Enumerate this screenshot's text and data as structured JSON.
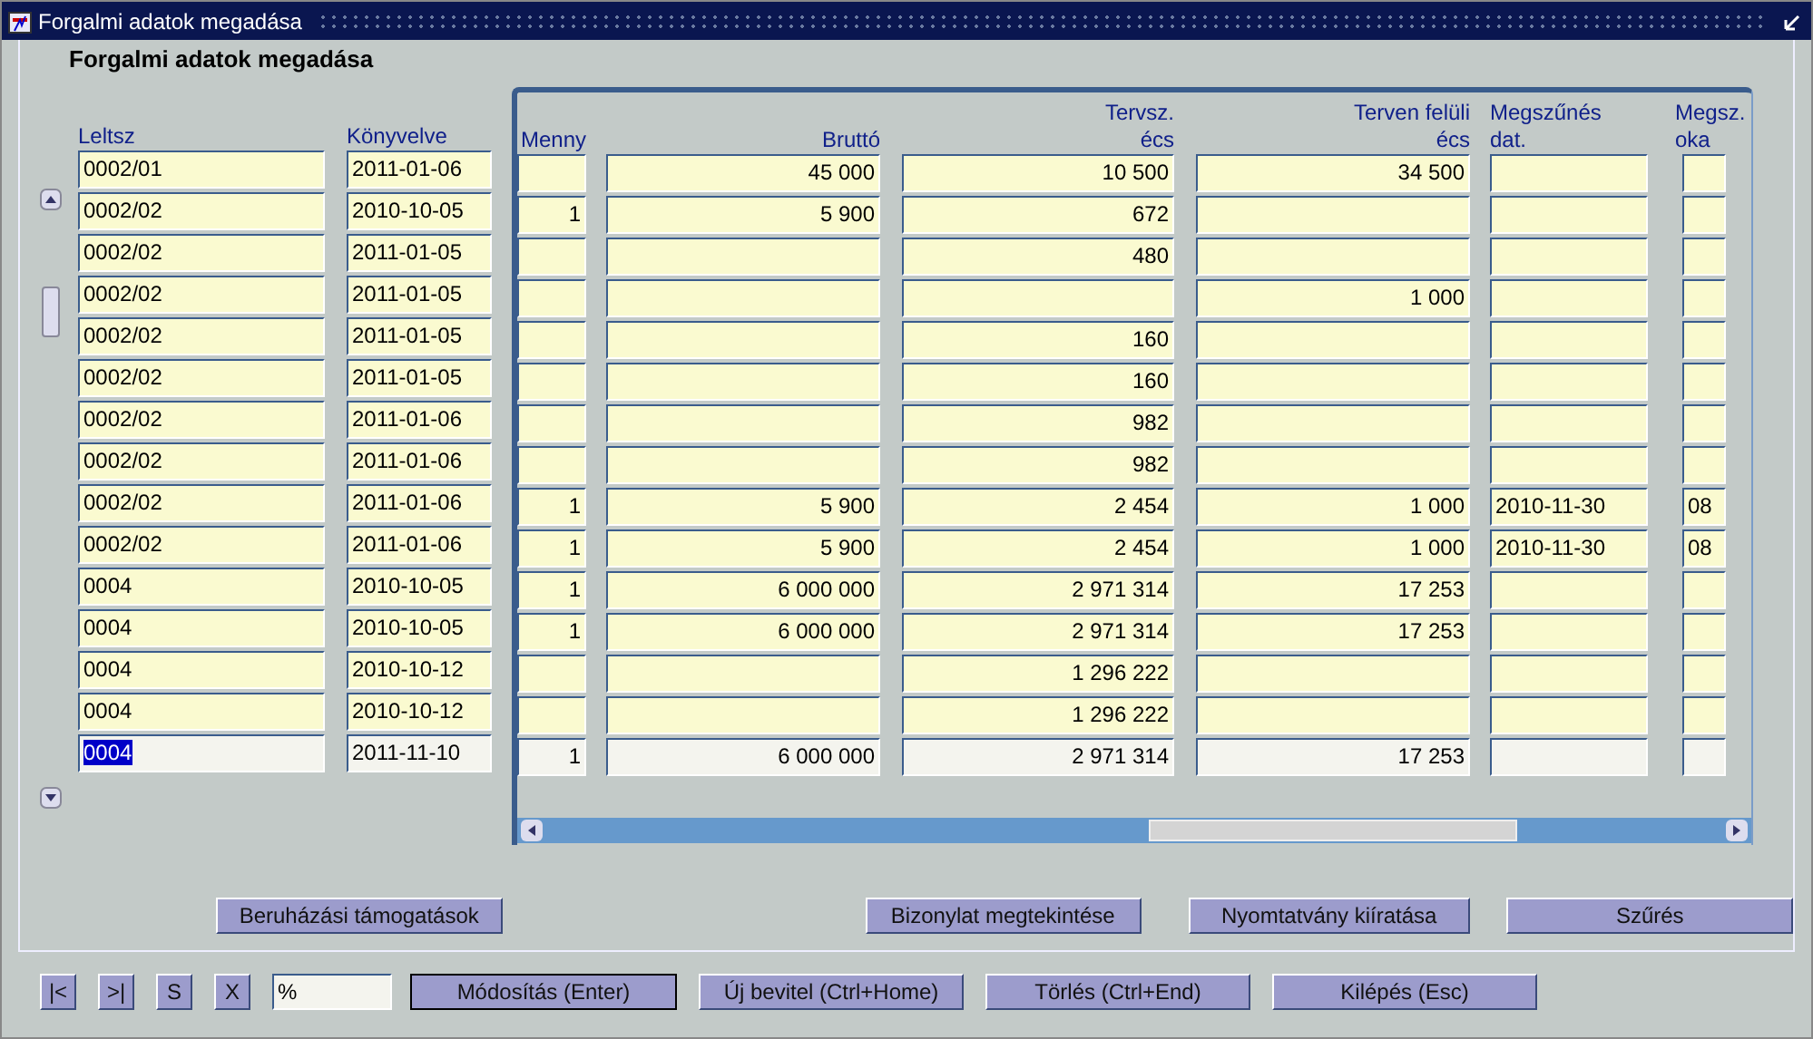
{
  "window": {
    "title": "Forgalmi adatok megadása"
  },
  "form_title": "Forgalmi adatok megadása",
  "columns": [
    {
      "label": "Leltsz"
    },
    {
      "label": "Könyvelve"
    },
    {
      "label": "Menny"
    },
    {
      "label": "Bruttó"
    },
    {
      "label": "Tervsz. écs"
    },
    {
      "label": "Terven felüli écs"
    },
    {
      "label": "Megszűnés dat."
    },
    {
      "label": "Megsz. oka"
    }
  ],
  "rows": [
    {
      "selected": false,
      "cells": [
        "0002/01",
        "2011-01-06",
        "",
        "45 000",
        "10 500",
        "34 500",
        "",
        ""
      ]
    },
    {
      "selected": false,
      "cells": [
        "0002/02",
        "2010-10-05",
        "1",
        "5 900",
        "672",
        "",
        "",
        ""
      ]
    },
    {
      "selected": false,
      "cells": [
        "0002/02",
        "2011-01-05",
        "",
        "",
        "480",
        "",
        "",
        ""
      ]
    },
    {
      "selected": false,
      "cells": [
        "0002/02",
        "2011-01-05",
        "",
        "",
        "",
        "1 000",
        "",
        ""
      ]
    },
    {
      "selected": false,
      "cells": [
        "0002/02",
        "2011-01-05",
        "",
        "",
        "160",
        "",
        "",
        ""
      ]
    },
    {
      "selected": false,
      "cells": [
        "0002/02",
        "2011-01-05",
        "",
        "",
        "160",
        "",
        "",
        ""
      ]
    },
    {
      "selected": false,
      "cells": [
        "0002/02",
        "2011-01-06",
        "",
        "",
        "982",
        "",
        "",
        ""
      ]
    },
    {
      "selected": false,
      "cells": [
        "0002/02",
        "2011-01-06",
        "",
        "",
        "982",
        "",
        "",
        ""
      ]
    },
    {
      "selected": false,
      "cells": [
        "0002/02",
        "2011-01-06",
        "1",
        "5 900",
        "2 454",
        "1 000",
        "2010-11-30",
        "08"
      ]
    },
    {
      "selected": false,
      "cells": [
        "0002/02",
        "2011-01-06",
        "1",
        "5 900",
        "2 454",
        "1 000",
        "2010-11-30",
        "08"
      ]
    },
    {
      "selected": false,
      "cells": [
        "0004",
        "2010-10-05",
        "1",
        "6 000 000",
        "2 971 314",
        "17 253",
        "",
        ""
      ]
    },
    {
      "selected": false,
      "cells": [
        "0004",
        "2010-10-05",
        "1",
        "6 000 000",
        "2 971 314",
        "17 253",
        "",
        ""
      ]
    },
    {
      "selected": false,
      "cells": [
        "0004",
        "2010-10-12",
        "",
        "",
        "1 296 222",
        "",
        "",
        ""
      ]
    },
    {
      "selected": false,
      "cells": [
        "0004",
        "2010-10-12",
        "",
        "",
        "1 296 222",
        "",
        "",
        ""
      ]
    },
    {
      "selected": true,
      "cells": [
        "0004",
        "2011-11-10",
        "1",
        "6 000 000",
        "2 971 314",
        "17 253",
        "",
        ""
      ]
    }
  ],
  "action_buttons": [
    "Beruházási támogatások",
    "Bizonylat megtekintése",
    "Nyomtatvány kiíratása",
    "Szűrés"
  ],
  "nav_buttons": [
    "|<",
    ">|",
    "S",
    "X"
  ],
  "filter": {
    "value": "%"
  },
  "command_buttons": [
    {
      "label": "Módosítás (Enter)",
      "default": true
    },
    {
      "label": "Új bevitel (Ctrl+Home)",
      "default": false
    },
    {
      "label": "Törlés (Ctrl+End)",
      "default": false
    },
    {
      "label": "Kilépés (Esc)",
      "default": false
    }
  ]
}
